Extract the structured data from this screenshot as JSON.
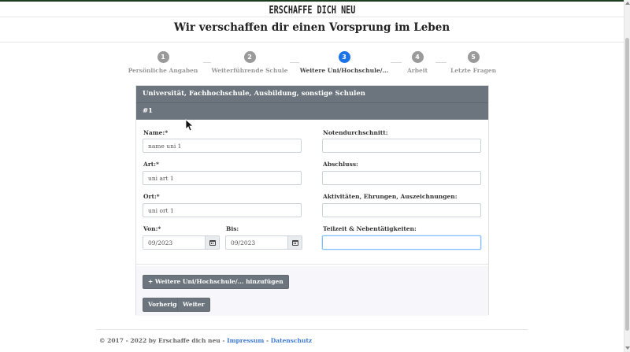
{
  "brand": "ERSCHAFFE DICH NEU",
  "headline": "Wir verschaffen dir einen Vorsprung im Leben",
  "steps": [
    {
      "num": "1",
      "label": "Persönliche Angaben"
    },
    {
      "num": "2",
      "label": "Weiterführende Schule"
    },
    {
      "num": "3",
      "label": "Weitere Uni/Hochschule/..."
    },
    {
      "num": "4",
      "label": "Arbeit"
    },
    {
      "num": "5",
      "label": "Letzte Fragen"
    }
  ],
  "card": {
    "header": "Universität, Fachhochschule, Ausbildung, sonstige Schulen",
    "entry": "#1"
  },
  "form": {
    "name_label": "Name:*",
    "name_value": "name uni 1",
    "art_label": "Art:*",
    "art_value": "uni art 1",
    "ort_label": "Ort:*",
    "ort_value": "uni ort 1",
    "von_label": "Von:*",
    "von_value": "09/2023",
    "bis_label": "Bis:",
    "bis_value": "09/2023",
    "noten_label": "Notendurchschnitt:",
    "noten_value": "",
    "abschluss_label": "Abschluss:",
    "abschluss_value": "",
    "aktiv_label": "Aktivitäten, Ehrungen, Auszeichnungen:",
    "aktiv_value": "",
    "teilzeit_label": "Teilzeit & Nebentätigkeiten:",
    "teilzeit_value": ""
  },
  "buttons": {
    "add": "+ Weitere Uni/Hochschule/... hinzufügen",
    "prev": "Vorherige",
    "next": "Weiter"
  },
  "footer": {
    "copyright": "© 2017 - 2022 by Erschaffe dich neu -",
    "impressum": "Impressum",
    "sep": "-",
    "datenschutz": "Datenschutz"
  },
  "colors": {
    "active_step": "#1a73e8",
    "inactive_step": "#9a9a9a",
    "card_header": "#6c757d",
    "link": "#3d7ad6"
  }
}
